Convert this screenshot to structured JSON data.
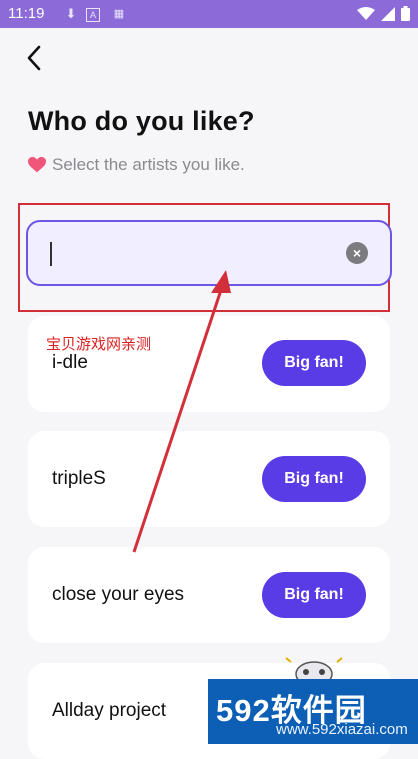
{
  "statusbar": {
    "time": "11:19",
    "icons": [
      "download-icon",
      "a-badge-icon",
      "keyboard-icon",
      "wifi-icon",
      "signal-icon",
      "battery-icon"
    ]
  },
  "page": {
    "title": "Who do you like?",
    "subtitle": "Select the artists you like."
  },
  "search": {
    "value": "",
    "placeholder": ""
  },
  "artists": [
    {
      "name": "i-dle",
      "button": "Big fan!"
    },
    {
      "name": "tripleS",
      "button": "Big fan!"
    },
    {
      "name": "close your eyes",
      "button": "Big fan!"
    },
    {
      "name": "Allday project",
      "button": ""
    }
  ],
  "watermarks": {
    "note": "宝贝游戏网亲测",
    "site_main": "592软件园",
    "site_url": "www.592xiazai.com"
  },
  "colors": {
    "accent": "#5a3ce6",
    "statusbar": "#8c6ad8",
    "annotation": "#d32f3a"
  }
}
